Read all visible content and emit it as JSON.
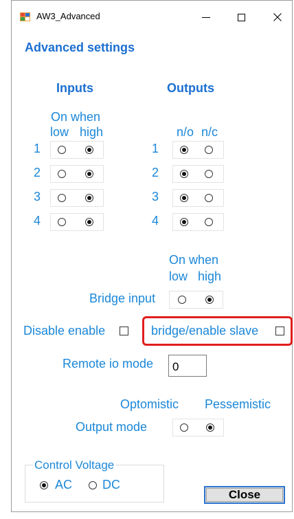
{
  "window": {
    "title": "AW3_Advanced",
    "controls": {
      "minimize": "—",
      "maximize": "☐",
      "close": "✕"
    }
  },
  "page_title": "Advanced settings",
  "inputs": {
    "heading": "Inputs",
    "caption_line1": "On when",
    "col_low": "low",
    "col_high": "high",
    "rows": [
      {
        "num": "1",
        "selected": "high"
      },
      {
        "num": "2",
        "selected": "high"
      },
      {
        "num": "3",
        "selected": "high"
      },
      {
        "num": "4",
        "selected": "high"
      }
    ]
  },
  "outputs": {
    "heading": "Outputs",
    "col_no": "n/o",
    "col_nc": "n/c",
    "rows": [
      {
        "num": "1",
        "selected": "n/o"
      },
      {
        "num": "2",
        "selected": "n/o"
      },
      {
        "num": "3",
        "selected": "n/o"
      },
      {
        "num": "4",
        "selected": "n/o"
      }
    ]
  },
  "bridge": {
    "caption_line1": "On when",
    "col_low": "low",
    "col_high": "high",
    "label": "Bridge input",
    "selected": "high"
  },
  "disable_enable": {
    "label": "Disable enable",
    "checked": false
  },
  "bridge_enable_slave": {
    "label": "bridge/enable slave",
    "checked": false
  },
  "remote_io": {
    "label": "Remote io mode",
    "value": "0"
  },
  "output_mode": {
    "label": "Output mode",
    "opt1": "Optomistic",
    "opt2": "Pessemistic",
    "selected": "Pessemistic"
  },
  "control_voltage": {
    "legend": "Control Voltage",
    "ac": "AC",
    "dc": "DC",
    "selected": "AC"
  },
  "close_button": "Close",
  "colors": {
    "label": "#1b87d8",
    "heading": "#1b6fd1",
    "highlight": "#e01e1e"
  }
}
